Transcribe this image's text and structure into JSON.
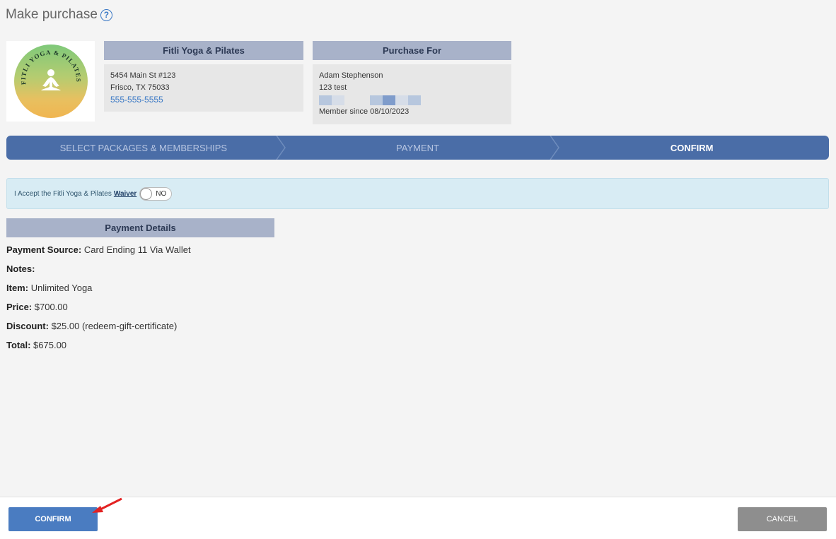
{
  "page": {
    "title": "Make purchase",
    "help_icon": "help-circle-icon"
  },
  "logo": {
    "text": "FITLI YOGA & PILATES"
  },
  "studio": {
    "name": "Fitli Yoga & Pilates",
    "address1": "5454 Main St #123",
    "address2": "Frisco, TX 75033",
    "phone": "555-555-5555"
  },
  "purchase_for": {
    "header": "Purchase For",
    "name": "Adam Stephenson",
    "note": "123 test",
    "member_since": "Member since 08/10/2023"
  },
  "steps": [
    {
      "label": "SELECT PACKAGES & MEMBERSHIPS",
      "active": false
    },
    {
      "label": "PAYMENT",
      "active": false
    },
    {
      "label": "CONFIRM",
      "active": true
    }
  ],
  "waiver": {
    "text": "I Accept the Fitli Yoga & Pilates",
    "link": "Waiver",
    "toggle_label": "NO"
  },
  "payment_details": {
    "header": "Payment Details",
    "rows": [
      {
        "label": "Payment Source:",
        "value": "Card Ending 11 Via Wallet"
      },
      {
        "label": "Notes:",
        "value": ""
      },
      {
        "label": "Item:",
        "value": "Unlimited Yoga"
      },
      {
        "label": "Price:",
        "value": "$700.00"
      },
      {
        "label": "Discount:",
        "value": "$25.00 (redeem-gift-certificate)"
      },
      {
        "label": "Total:",
        "value": "$675.00"
      }
    ]
  },
  "footer": {
    "confirm_label": "CONFIRM",
    "cancel_label": "CANCEL"
  },
  "colors": {
    "accent": "#4a6da7",
    "header_bg": "#a8b2c9",
    "arrow": "#e32222"
  }
}
